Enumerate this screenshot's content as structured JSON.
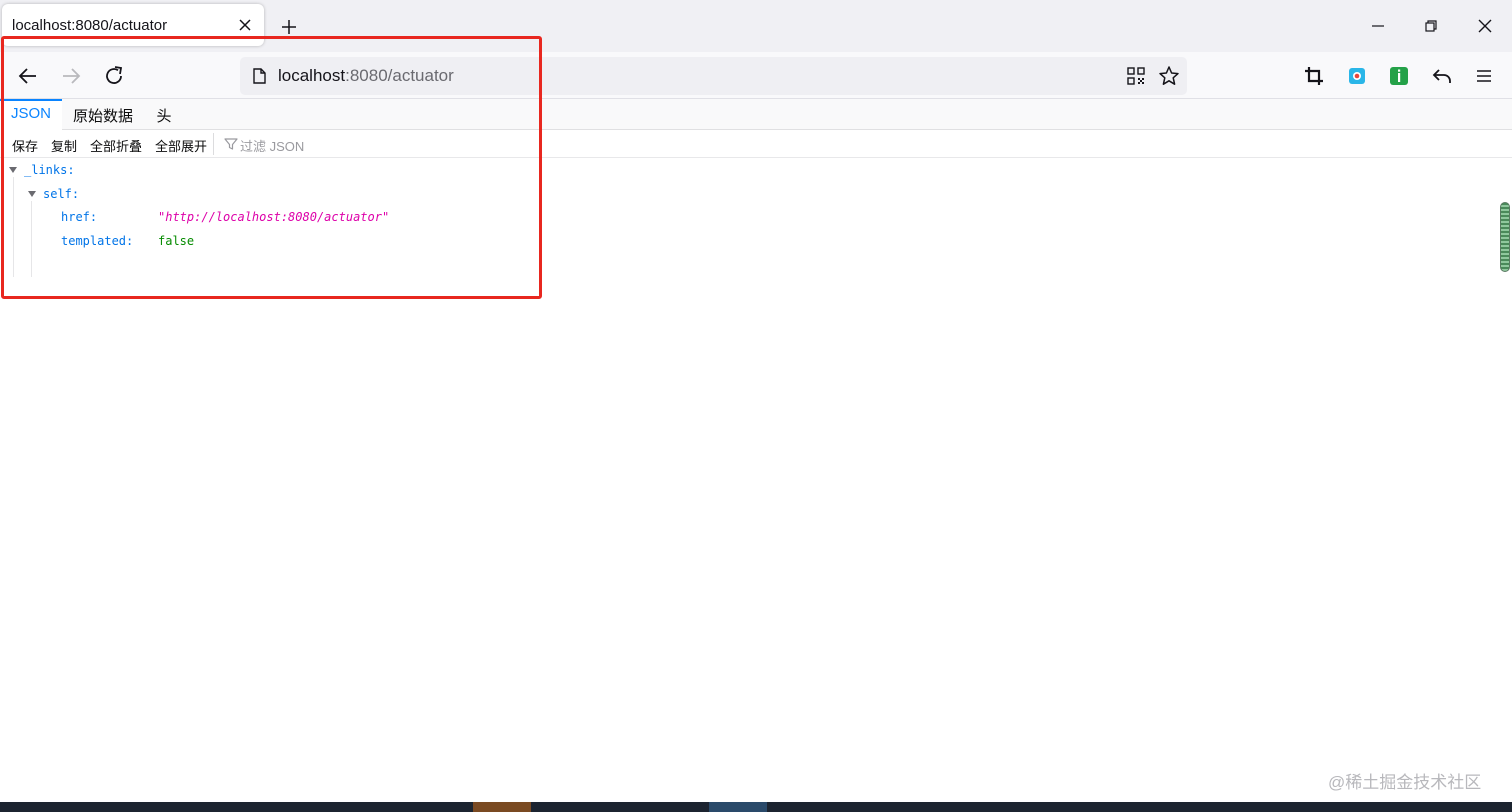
{
  "browser": {
    "tab_title": "localhost:8080/actuator",
    "url_host": "localhost",
    "url_rest": ":8080/actuator"
  },
  "viewer": {
    "tabs": [
      {
        "label": "JSON",
        "active": true
      },
      {
        "label": "原始数据",
        "active": false
      },
      {
        "label": "头",
        "active": false
      }
    ],
    "toolbar": {
      "save": "保存",
      "copy": "复制",
      "collapse_all": "全部折叠",
      "expand_all": "全部展开",
      "filter_placeholder": "过滤 JSON"
    }
  },
  "json_tree": {
    "links_key": "_links:",
    "self_key": "self:",
    "href_key": "href:",
    "href_value": "\"http://localhost:8080/actuator\"",
    "templated_key": "templated:",
    "templated_value": "false"
  },
  "watermark": "@稀土掘金技术社区",
  "colors": {
    "accent": "#0a84ff",
    "json_key": "#0074e8",
    "json_string": "#dd00a9",
    "json_bool": "#058b00",
    "annotation": "#e8271f"
  },
  "icons": [
    "close-icon",
    "plus-icon",
    "minimize-icon",
    "restore-icon",
    "window-close-icon",
    "back-arrow-icon",
    "forward-arrow-icon",
    "reload-icon",
    "document-icon",
    "qr-code-icon",
    "star-icon",
    "crop-icon",
    "screenshot-extension-icon",
    "green-extension-icon",
    "undo-icon",
    "hamburger-menu-icon",
    "filter-icon",
    "twisty-icon"
  ]
}
